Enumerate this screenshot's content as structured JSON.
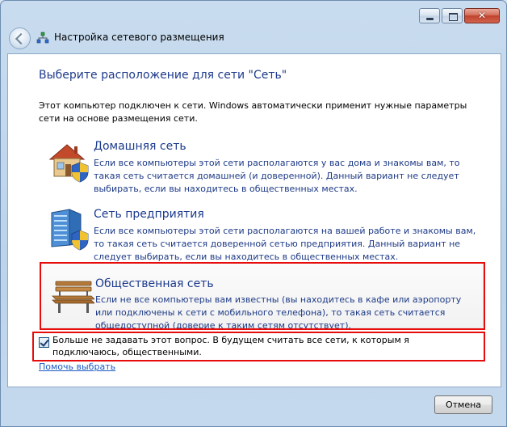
{
  "window": {
    "title": "Настройка сетевого размещения",
    "close_symbol": "✕"
  },
  "main": {
    "heading": "Выберите расположение для сети \"Сеть\"",
    "intro": "Этот компьютер подключен к сети. Windows автоматически применит нужные параметры сети на основе размещения сети."
  },
  "options": [
    {
      "title": "Домашняя сеть",
      "description": "Если все компьютеры этой сети располагаются у вас дома и знакомы вам, то такая сеть считается домашней (и доверенной). Данный вариант не следует выбирать, если вы находитесь в общественных местах.",
      "icon": "home-shield-icon"
    },
    {
      "title": "Сеть предприятия",
      "description": "Если все компьютеры этой сети располагаются на вашей работе и знакомы вам, то такая сеть считается доверенной сетью предприятия. Данный вариант не следует выбирать, если вы находитесь в общественных местах.",
      "icon": "office-building-shield-icon"
    },
    {
      "title": "Общественная сеть",
      "description": "Если не все компьютеры вам известны (вы находитесь в кафе или аэропорту или подключены к сети с мобильного телефона), то такая сеть считается общедоступной (доверие к таким сетям отсутствует).",
      "icon": "park-bench-icon"
    }
  ],
  "checkbox": {
    "checked": true,
    "label": "Больше не задавать этот вопрос. В будущем считать все сети, к которым я подключаюсь, общественными."
  },
  "help_link": "Помочь выбрать",
  "footer": {
    "cancel_label": "Отмена"
  },
  "colors": {
    "heading": "#1e3b8c",
    "highlight": "#e60c0c",
    "link": "#1a5bc4"
  }
}
